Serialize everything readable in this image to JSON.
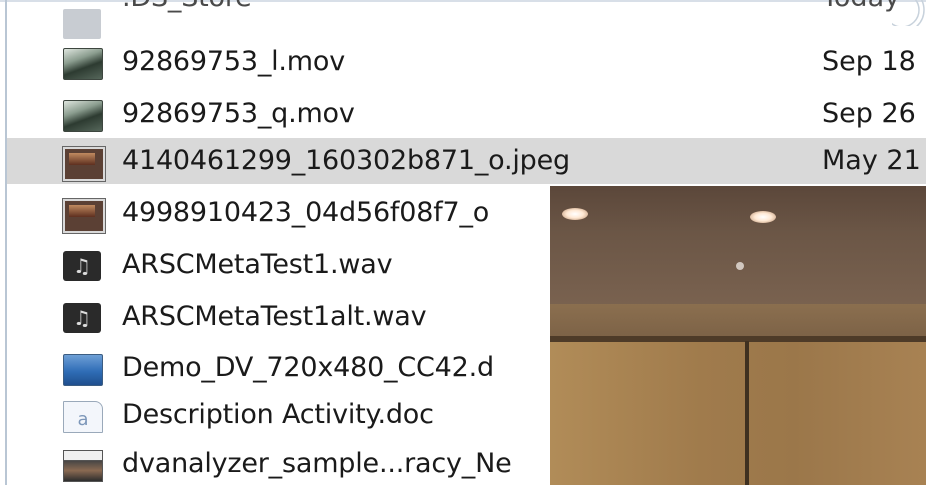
{
  "files": [
    {
      "icon": "ds-store-icon",
      "name": ".DS_Store",
      "date": "Today"
    },
    {
      "icon": "movie-icon",
      "name": "92869753_l.mov",
      "date": "Sep 18"
    },
    {
      "icon": "movie-icon",
      "name": "92869753_q.mov",
      "date": "Sep 26"
    },
    {
      "icon": "jpeg-icon",
      "name": "4140461299_160302b871_o.jpeg",
      "date": "May 21"
    },
    {
      "icon": "jpeg-icon",
      "name": "4998910423_04d56f08f7_o",
      "date": ""
    },
    {
      "icon": "audio-icon",
      "name": "ARSCMetaTest1.wav",
      "date": ""
    },
    {
      "icon": "audio-icon",
      "name": "ARSCMetaTest1alt.wav",
      "date": ""
    },
    {
      "icon": "video-icon",
      "name": "Demo_DV_720x480_CC42.d",
      "date": ""
    },
    {
      "icon": "document-icon",
      "name": "Description Activity.doc",
      "date": ""
    },
    {
      "icon": "video-icon",
      "name": "dvanalyzer_sample...racy_Ne",
      "date": ""
    }
  ],
  "selected_index": 3,
  "colors": {
    "selection": "#d9d9d9",
    "text": "#1a1a1a",
    "border": "#b9c6d4"
  }
}
